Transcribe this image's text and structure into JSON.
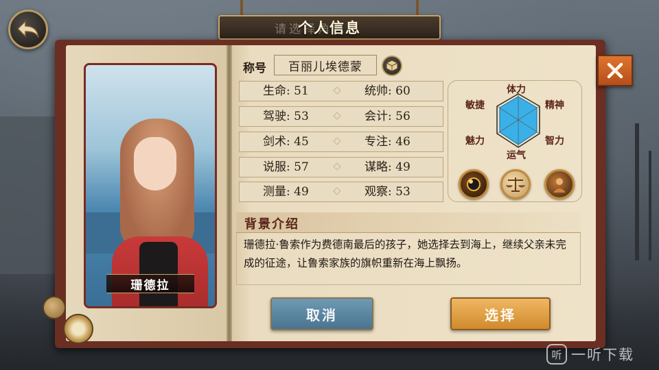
{
  "header": {
    "title": "个人信息",
    "ghost_title": "请选择角色"
  },
  "character": {
    "name": "珊德拉",
    "title_label": "称号",
    "title_value": "百丽儿埃德蒙"
  },
  "stats": [
    {
      "left_label": "生命",
      "left_value": "51",
      "right_label": "统帅",
      "right_value": "60"
    },
    {
      "left_label": "驾驶",
      "left_value": "53",
      "right_label": "会计",
      "right_value": "56"
    },
    {
      "left_label": "剑术",
      "left_value": "45",
      "right_label": "专注",
      "right_value": "46"
    },
    {
      "left_label": "说服",
      "left_value": "57",
      "right_label": "谋略",
      "right_value": "49"
    },
    {
      "left_label": "测量",
      "left_value": "49",
      "right_label": "观察",
      "right_value": "53"
    }
  ],
  "radar": {
    "labels": {
      "top": "体力",
      "top_left": "敏捷",
      "top_right": "精神",
      "bottom_left": "魅力",
      "bottom_right": "智力",
      "bottom": "运气"
    },
    "fill_color": "#3ab0e8"
  },
  "skills": [
    {
      "icon": "cannon-skill-icon"
    },
    {
      "icon": "scales-skill-icon"
    },
    {
      "icon": "portrait-skill-icon"
    }
  ],
  "background": {
    "title": "背景介绍",
    "text": "珊德拉·鲁索作为费德南最后的孩子，她选择去到海上，继续父亲未完成的征途，让鲁索家族的旗帜重新在海上飘扬。"
  },
  "buttons": {
    "cancel": "取消",
    "select": "选择"
  },
  "watermark": {
    "logo_text": "听",
    "text": "一听下载"
  }
}
